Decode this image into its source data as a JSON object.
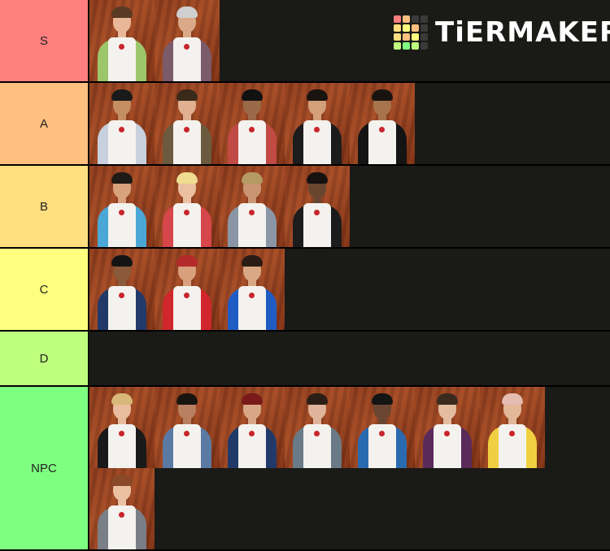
{
  "logo": {
    "text": "TiERMAKER",
    "grid_colors": [
      "#ff7f7f",
      "#ffbf7f",
      "#3a3a3a",
      "#3a3a3a",
      "#ffdf7f",
      "#ffff7f",
      "#ffbf7f",
      "#3a3a3a",
      "#ffdf7f",
      "#ffbf7f",
      "#ffff7f",
      "#3a3a3a",
      "#bfff7f",
      "#7fff7f",
      "#bfff7f",
      "#3a3a3a"
    ]
  },
  "tiers": [
    {
      "label": "S",
      "color": "#ff7f7f",
      "items": [
        {
          "shirt": "#9dc56a",
          "skin": "#e8b898",
          "hair": "#5a3a22"
        },
        {
          "shirt": "#7b5a6a",
          "skin": "#d9a988",
          "hair": "#cfcfcf"
        }
      ]
    },
    {
      "label": "A",
      "color": "#ffbf7f",
      "items": [
        {
          "shirt": "#c7d0dc",
          "skin": "#c58d62",
          "hair": "#1a1a1a"
        },
        {
          "shirt": "#6b5a3e",
          "skin": "#e0b090",
          "hair": "#3a2a1a"
        },
        {
          "shirt": "#c24a44",
          "skin": "#9a6a48",
          "hair": "#111111"
        },
        {
          "shirt": "#1c1c1c",
          "skin": "#d3a07a",
          "hair": "#1a1411"
        },
        {
          "shirt": "#141414",
          "skin": "#a8744e",
          "hair": "#1a1411"
        }
      ]
    },
    {
      "label": "B",
      "color": "#ffdf7f",
      "items": [
        {
          "shirt": "#4aa7d6",
          "skin": "#d7a27c",
          "hair": "#1e1a16"
        },
        {
          "shirt": "#d6464a",
          "skin": "#eac0a0",
          "hair": "#f0dc90"
        },
        {
          "shirt": "#8a96a6",
          "skin": "#c99572",
          "hair": "#b59a64"
        },
        {
          "shirt": "#1c1c1c",
          "skin": "#6a4630",
          "hair": "#161210"
        }
      ]
    },
    {
      "label": "C",
      "color": "#ffff7f",
      "items": [
        {
          "shirt": "#223a6a",
          "skin": "#8a5a3a",
          "hair": "#141414"
        },
        {
          "shirt": "#d0262c",
          "skin": "#d9a07e",
          "hair": "#b42a2a"
        },
        {
          "shirt": "#1f5cc4",
          "skin": "#d9a884",
          "hair": "#2a1c14"
        }
      ]
    },
    {
      "label": "D",
      "color": "#bfff7f",
      "items": []
    },
    {
      "label": "NPC",
      "color": "#7fff7f",
      "items": [
        {
          "shirt": "#1a1a1a",
          "skin": "#e8bc9c",
          "hair": "#d8b878"
        },
        {
          "shirt": "#5a7aa4",
          "skin": "#b88060",
          "hair": "#1a1411"
        },
        {
          "shirt": "#223a6a",
          "skin": "#d8a886",
          "hair": "#7a1a1a"
        },
        {
          "shirt": "#6a7a86",
          "skin": "#e0b49a",
          "hair": "#2a1e16"
        },
        {
          "shirt": "#2a6ab0",
          "skin": "#6a4632",
          "hair": "#141414"
        },
        {
          "shirt": "#5a2a5a",
          "skin": "#e4bca0",
          "hair": "#3a2a1e"
        },
        {
          "shirt": "#f0d040",
          "skin": "#e2b898",
          "hair": "#e4bcb0"
        },
        {
          "shirt": "#7a7e86",
          "skin": "#ecc0a2",
          "hair": "#8a4a2a"
        }
      ]
    }
  ]
}
